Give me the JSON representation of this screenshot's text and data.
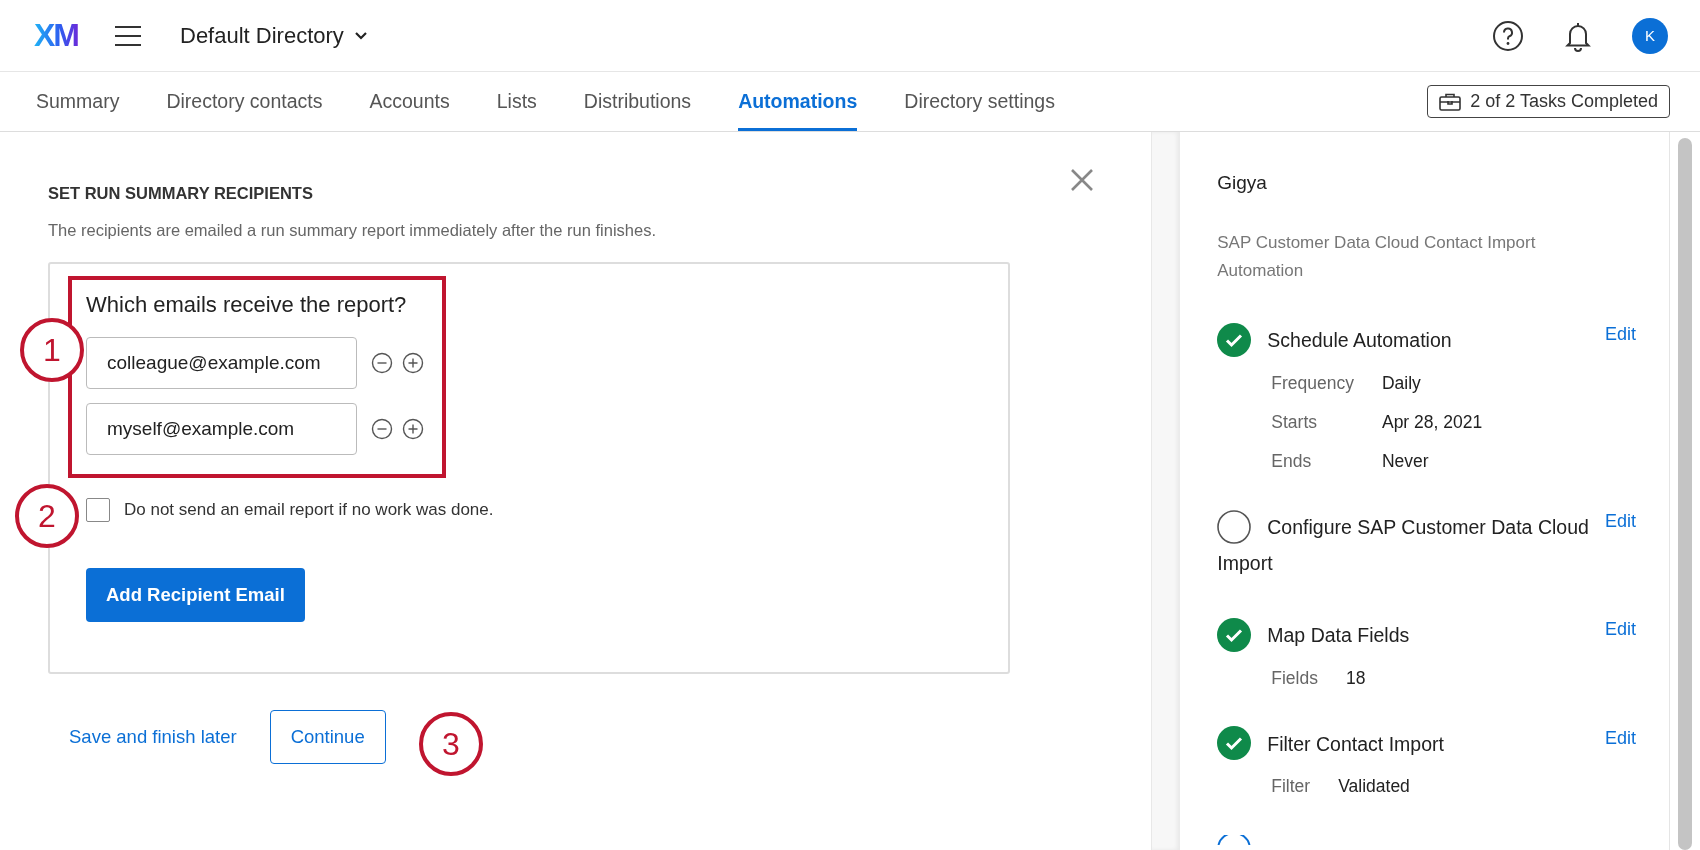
{
  "header": {
    "logo": "XM",
    "directory": "Default Directory",
    "avatar": "K"
  },
  "tabs": [
    {
      "label": "Summary",
      "selected": false
    },
    {
      "label": "Directory contacts",
      "selected": false
    },
    {
      "label": "Accounts",
      "selected": false
    },
    {
      "label": "Lists",
      "selected": false
    },
    {
      "label": "Distributions",
      "selected": false
    },
    {
      "label": "Automations",
      "selected": true
    },
    {
      "label": "Directory settings",
      "selected": false
    }
  ],
  "tasks_button": "2 of 2 Tasks Completed",
  "form": {
    "title": "SET RUN SUMMARY RECIPIENTS",
    "description": "The recipients are emailed a run summary report immediately after the run finishes.",
    "question": "Which emails receive the report?",
    "emails": [
      "colleague@example.com",
      "myself@example.com"
    ],
    "skip_empty": {
      "label": "Do not send an email report if no work was done.",
      "checked": false
    },
    "add_button": "Add Recipient Email"
  },
  "footer": {
    "save_link": "Save and finish later",
    "continue_button": "Continue"
  },
  "callouts": [
    "1",
    "2",
    "3"
  ],
  "panel": {
    "source": "Gigya",
    "automation": "SAP Customer Data Cloud Contact Import Automation",
    "steps": [
      {
        "title": "Schedule Automation",
        "done": true,
        "edit": "Edit",
        "details": [
          {
            "label": "Frequency",
            "value": "Daily"
          },
          {
            "label": "Starts",
            "value": "Apr 28, 2021"
          },
          {
            "label": "Ends",
            "value": "Never"
          }
        ]
      },
      {
        "title": "Configure SAP Customer Data Cloud Import",
        "done": false,
        "edit": "Edit"
      },
      {
        "title": "Map Data Fields",
        "done": true,
        "edit": "Edit",
        "details": [
          {
            "label": "Fields",
            "value": "18"
          }
        ]
      },
      {
        "title": "Filter Contact Import",
        "done": true,
        "edit": "Edit",
        "details": [
          {
            "label": "Filter",
            "value": "Validated"
          }
        ]
      }
    ]
  }
}
